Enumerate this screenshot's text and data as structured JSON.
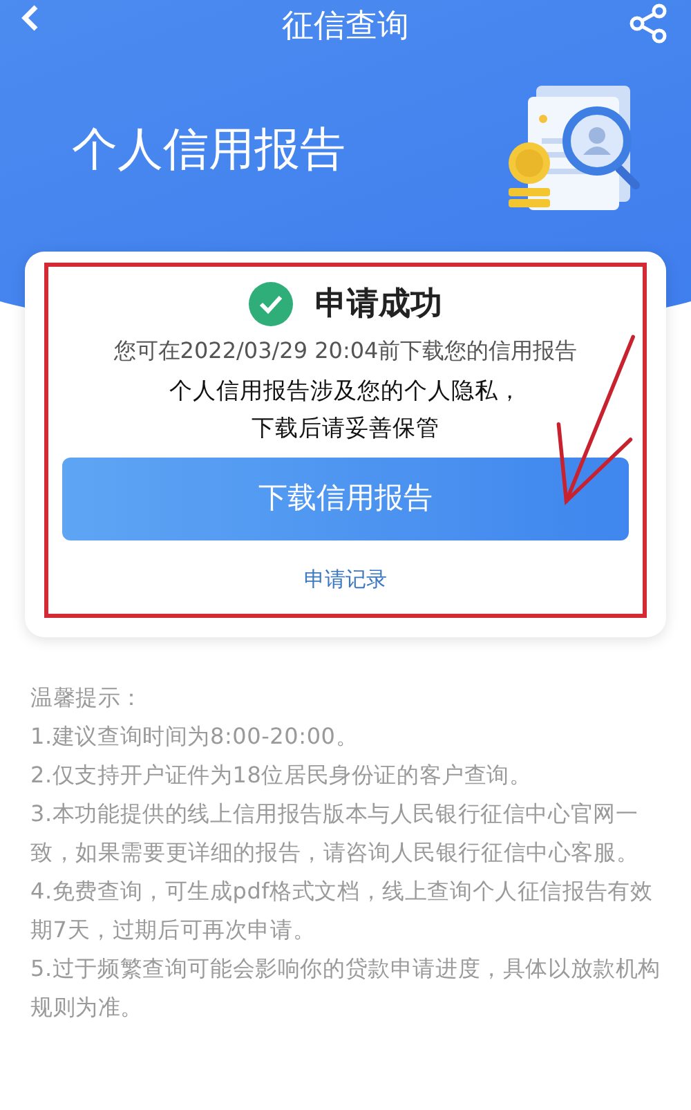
{
  "nav_bar": {
    "title": "征信查询"
  },
  "hero": {
    "title": "个人信用报告"
  },
  "result_card": {
    "status": "申请成功",
    "deadline_note": "您可在2022/03/29 20:04前下载您的信用报告",
    "privacy_lines": [
      "个人信用报告涉及您的个人隐私，",
      "下载后请妥善保管"
    ],
    "primary_button": "下载信用报告",
    "secondary_link": "申请记录",
    "annotated": true
  },
  "tips": {
    "heading": "温馨提示：",
    "items": [
      "1.建议查询时间为8:00-20:00。",
      "2.仅支持开户证件为18位居民身份证的客户查询。",
      "3.本功能提供的线上信用报告版本与人民银行征信中心官网一致，如果需要更详细的报告，请咨询人民银行征信中心客服。",
      "4.免费查询，可生成pdf格式文档，线上查询个人征信报告有效期7天，过期后可再次申请。",
      "5.过于频繁查询可能会影响你的贷款申请进度，具体以放款机构规则为准。"
    ]
  }
}
